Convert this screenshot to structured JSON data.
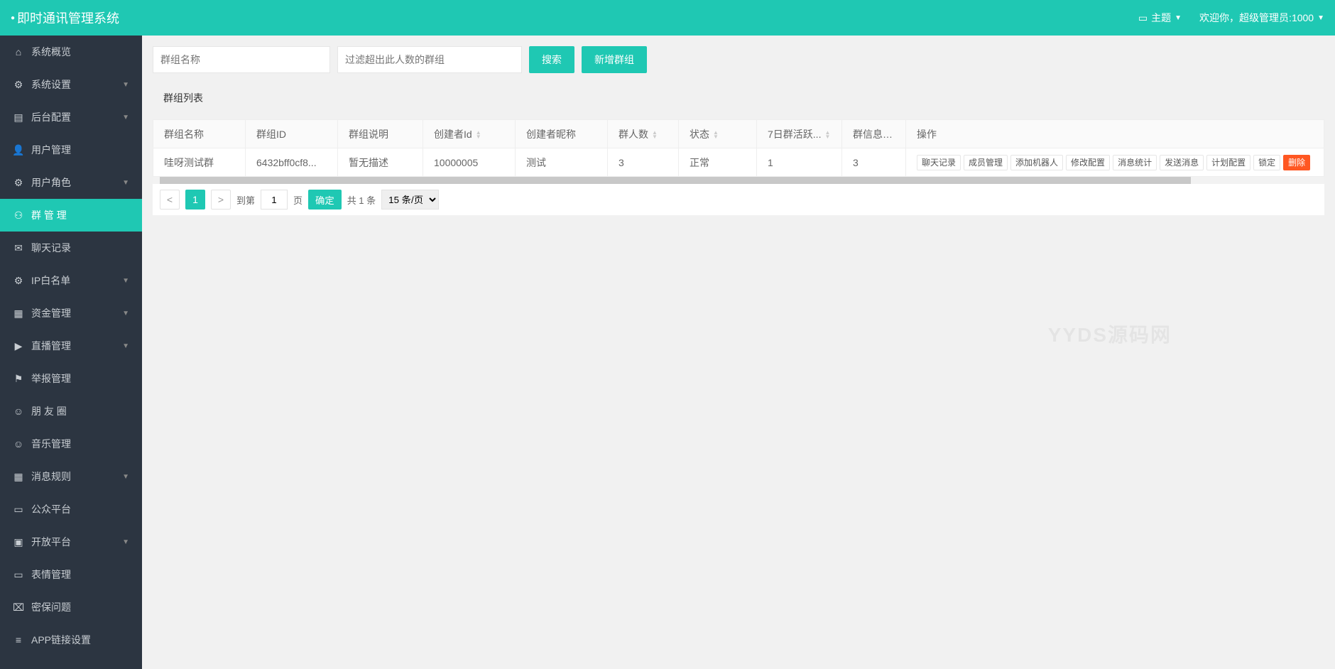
{
  "header": {
    "title": "即时通讯管理系统",
    "theme_label": "主题",
    "welcome_prefix": "欢迎你，超级管理员:",
    "welcome_user": "1000"
  },
  "sidebar": {
    "items": [
      {
        "icon": "home",
        "label": "系统概览",
        "expandable": false
      },
      {
        "icon": "gear",
        "label": "系统设置",
        "expandable": true
      },
      {
        "icon": "list",
        "label": "后台配置",
        "expandable": true
      },
      {
        "icon": "user",
        "label": "用户管理",
        "expandable": false
      },
      {
        "icon": "gear",
        "label": "用户角色",
        "expandable": true
      },
      {
        "icon": "users",
        "label": "群 管 理",
        "expandable": false,
        "active": true
      },
      {
        "icon": "chat",
        "label": "聊天记录",
        "expandable": false
      },
      {
        "icon": "gear",
        "label": "IP白名单",
        "expandable": true
      },
      {
        "icon": "wallet",
        "label": "资金管理",
        "expandable": true
      },
      {
        "icon": "play",
        "label": "直播管理",
        "expandable": true
      },
      {
        "icon": "flag",
        "label": "举报管理",
        "expandable": false
      },
      {
        "icon": "smile",
        "label": "朋 友 圈",
        "expandable": false
      },
      {
        "icon": "smile",
        "label": "音乐管理",
        "expandable": false
      },
      {
        "icon": "calendar",
        "label": "消息规则",
        "expandable": true
      },
      {
        "icon": "display",
        "label": "公众平台",
        "expandable": false
      },
      {
        "icon": "box",
        "label": "开放平台",
        "expandable": true
      },
      {
        "icon": "card",
        "label": "表情管理",
        "expandable": false
      },
      {
        "icon": "lock",
        "label": "密保问题",
        "expandable": false
      },
      {
        "icon": "stack",
        "label": "APP链接设置",
        "expandable": false
      }
    ]
  },
  "toolbar": {
    "search_placeholder": "群组名称",
    "filter_placeholder": "过滤超出此人数的群组",
    "search_btn": "搜索",
    "add_btn": "新增群组"
  },
  "panel": {
    "title": "群组列表"
  },
  "table": {
    "columns": [
      {
        "label": "群组名称",
        "sortable": false
      },
      {
        "label": "群组ID",
        "sortable": false
      },
      {
        "label": "群组说明",
        "sortable": false
      },
      {
        "label": "创建者Id",
        "sortable": true
      },
      {
        "label": "创建者昵称",
        "sortable": false
      },
      {
        "label": "群人数",
        "sortable": true
      },
      {
        "label": "状态",
        "sortable": true
      },
      {
        "label": "7日群活跃...",
        "sortable": true
      },
      {
        "label": "群信息条数",
        "sortable": false
      },
      {
        "label": "操作",
        "sortable": false
      }
    ],
    "rows": [
      {
        "name": "哇呀测试群",
        "id": "6432bff0cf8...",
        "desc": "暂无描述",
        "creator_id": "10000005",
        "creator_name": "测试",
        "count": "3",
        "status": "正常",
        "activity": "1",
        "msgcount": "3",
        "ops": [
          {
            "label": "聊天记录",
            "danger": false
          },
          {
            "label": "成员管理",
            "danger": false
          },
          {
            "label": "添加机器人",
            "danger": false
          },
          {
            "label": "修改配置",
            "danger": false
          },
          {
            "label": "消息统计",
            "danger": false
          },
          {
            "label": "发送消息",
            "danger": false
          },
          {
            "label": "计划配置",
            "danger": false
          },
          {
            "label": "锁定",
            "danger": false
          },
          {
            "label": "删除",
            "danger": true
          }
        ]
      }
    ]
  },
  "pager": {
    "page": "1",
    "goto_label": "到第",
    "page_unit": "页",
    "goto_value": "1",
    "confirm": "确定",
    "total": "共 1 条",
    "pagesize": "15 条/页"
  },
  "watermark": "YYDS源码网"
}
